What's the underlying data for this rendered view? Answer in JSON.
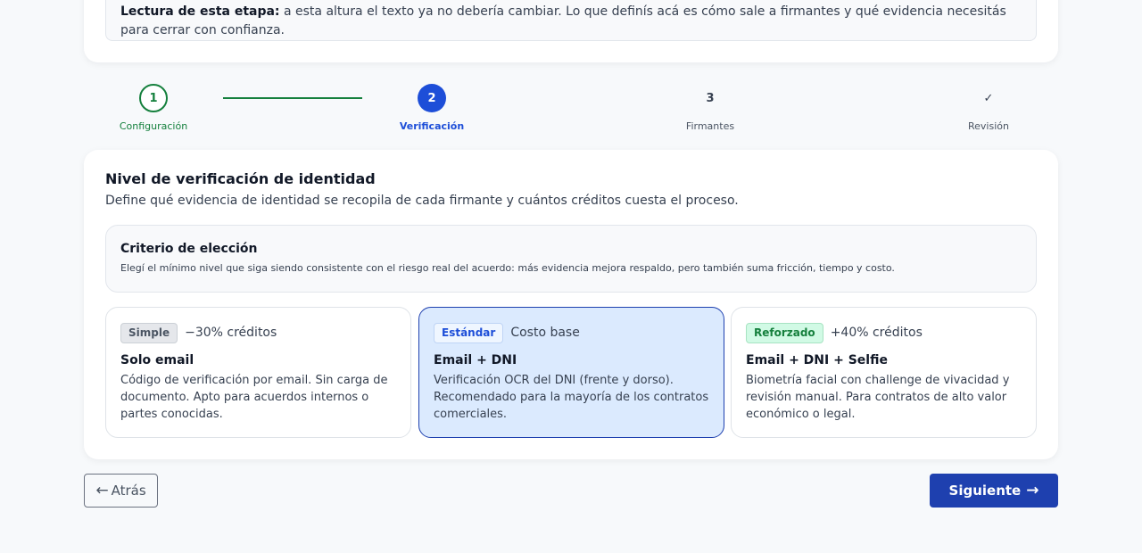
{
  "note": {
    "label": "Lectura de esta etapa:",
    "text": " a esta altura el texto ya no debería cambiar. Lo que definís acá es cómo sale a firmantes y qué evidencia necesitás para cerrar con confianza."
  },
  "stepper": {
    "steps": [
      {
        "number": "1",
        "label": "Configuración"
      },
      {
        "number": "2",
        "label": "Verificación"
      },
      {
        "number": "3",
        "label": "Firmantes"
      },
      {
        "number": "✓",
        "label": "Revisión"
      }
    ]
  },
  "verification": {
    "title": "Nivel de verificación de identidad",
    "subtitle": "Define qué evidencia de identidad se recopila de cada firmante y cuántos créditos cuesta el proceso.",
    "criteria_title": "Criterio de elección",
    "criteria_text": "Elegí el mínimo nivel que siga siendo consistente con el riesgo real del acuerdo: más evidencia mejora respaldo, pero también suma fricción, tiempo y costo.",
    "options": [
      {
        "badge": "Simple",
        "cost": "−30% créditos",
        "title": "Solo email",
        "description": "Código de verificación por email. Sin carga de documento. Apto para acuerdos internos o partes conocidas."
      },
      {
        "badge": "Estándar",
        "cost": "Costo base",
        "title": "Email + DNI",
        "description": "Verificación OCR del DNI (frente y dorso). Recomendado para la mayoría de los contratos comerciales."
      },
      {
        "badge": "Reforzado",
        "cost": "+40% créditos",
        "title": "Email + DNI + Selfie",
        "description": "Biometría facial con challenge de vivacidad y revisión manual. Para contratos de alto valor económico o legal."
      }
    ]
  },
  "nav": {
    "back_label": "Atrás",
    "next_label": "Siguiente"
  },
  "icons": {
    "back": "arrow-left-icon",
    "next": "arrow-right-icon"
  },
  "colors": {
    "primary": "#1e40af",
    "success": "#15803d",
    "selected_bg": "#dbeafe"
  }
}
